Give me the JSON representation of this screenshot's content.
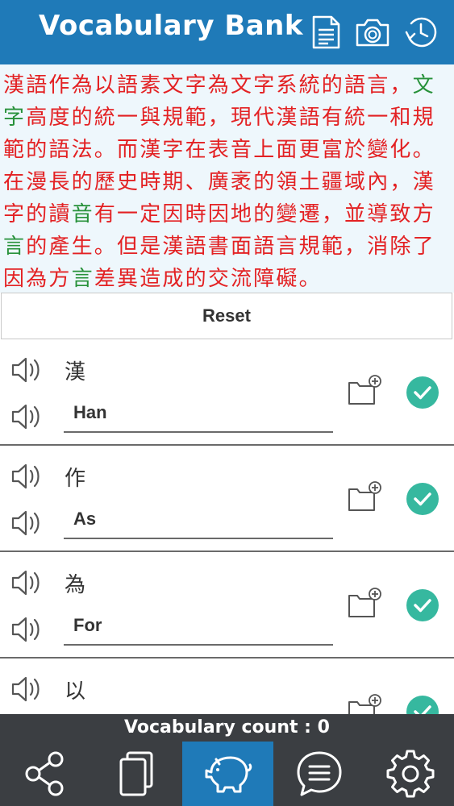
{
  "header": {
    "title": "Vocabulary Bank",
    "icons": [
      "document-icon",
      "camera-icon",
      "history-icon"
    ],
    "bg_color": "#1f7ab8"
  },
  "passage": {
    "segments": [
      {
        "text": "漢語作為以語素文字為文字系統的語言，",
        "color": "red"
      },
      {
        "text": "文字",
        "color": "green"
      },
      {
        "text": "高度的統一與規範，",
        "color": "red"
      },
      {
        "text": "現代漢語有統一和規範的語法。",
        "color": "red"
      },
      {
        "text": "而漢字在表音上面更富於變化。在漫長的歷史時期、廣袤的領土疆域內，漢字的讀",
        "color": "red"
      },
      {
        "text": "音",
        "color": "green"
      },
      {
        "text": "有一定因時因地的變遷，並導致方",
        "color": "red"
      },
      {
        "text": "言",
        "color": "green"
      },
      {
        "text": "的產生。但是漢語書面語言規範，消除了因為方",
        "color": "red"
      },
      {
        "text": "言",
        "color": "green"
      },
      {
        "text": "差異造成的交流障礙。",
        "color": "red"
      }
    ],
    "colors": {
      "red": "#e32123",
      "green": "#27913a"
    }
  },
  "reset_label": "Reset",
  "vocab": [
    {
      "word": "漢",
      "translation": "Han",
      "checked": true
    },
    {
      "word": "作",
      "translation": "As",
      "checked": true
    },
    {
      "word": "為",
      "translation": "For",
      "checked": true
    },
    {
      "word": "以",
      "translation": "",
      "checked": true
    }
  ],
  "count_label": "Vocabulary count : 0",
  "nav": {
    "items": [
      "share-icon",
      "cards-icon",
      "piggy-bank-icon",
      "chat-icon",
      "settings-icon"
    ],
    "active_index": 2
  },
  "accent_color": "#36b89f"
}
